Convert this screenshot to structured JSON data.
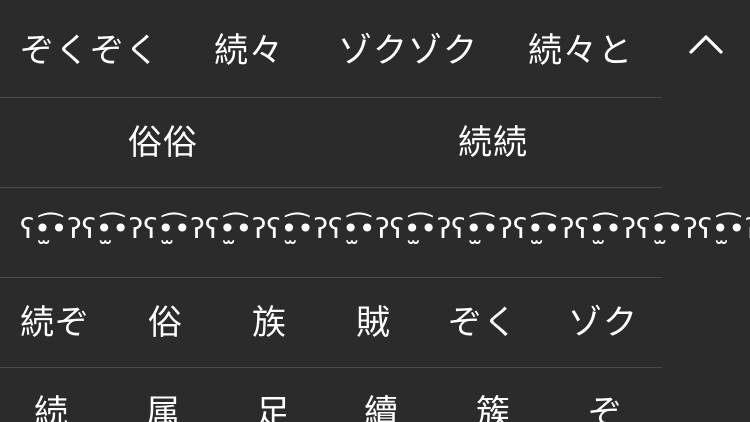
{
  "candidate_panel": {
    "rows": [
      {
        "items": [
          "ぞくぞく",
          "続々",
          "ゾクゾク",
          "続々と"
        ]
      },
      {
        "items": [
          "俗俗",
          "続続"
        ]
      },
      {
        "items": [
          "ʕ•̫͡•ʔʕ•̫͡•ʔʕ•̫͡•ʔʕ•̫͡•ʔʕ•̫͡•ʔʕ•̫͡•ʔʕ•̫͡•ʔʕ•̫͡•ʔʕ•̫͡•ʔʕ•̫͡•ʔʕ•̫͡•ʔʕ•̫͡•ʔ"
        ]
      },
      {
        "items": [
          "続ぞ",
          "俗",
          "族",
          "賊",
          "ぞく",
          "ゾク"
        ]
      },
      {
        "items": [
          "続",
          "属",
          "足",
          "續",
          "簇",
          "ぞ"
        ]
      }
    ]
  },
  "collapse_button": {
    "icon": "chevron-up-icon"
  },
  "colors": {
    "background": "#2b2b2b",
    "text": "#ffffff",
    "divider": "#4a4a4a"
  }
}
